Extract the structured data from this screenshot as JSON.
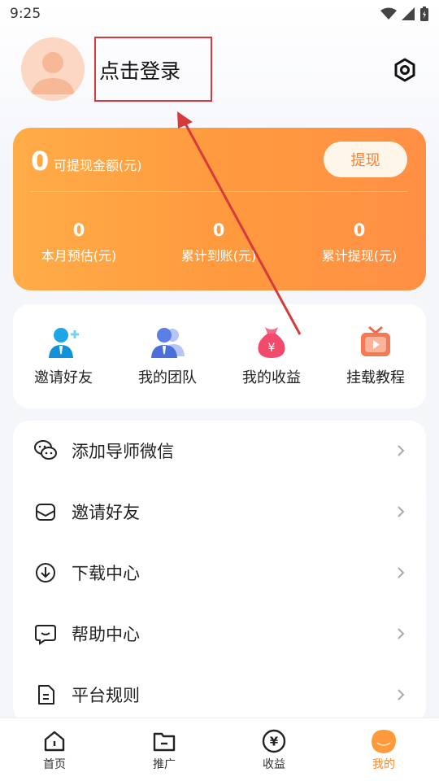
{
  "status_bar": {
    "time": "9:25"
  },
  "profile": {
    "login_text": "点击登录"
  },
  "earnings": {
    "withdrawable_amount": "0",
    "withdrawable_label": "可提现金额(元)",
    "withdraw_button": "提现",
    "stats": [
      {
        "value": "0",
        "label": "本月预估(元)"
      },
      {
        "value": "0",
        "label": "累计到账(元)"
      },
      {
        "value": "0",
        "label": "累计提现(元)"
      }
    ]
  },
  "quick_actions": [
    {
      "label": "邀请好友",
      "icon": "invite-friend-icon"
    },
    {
      "label": "我的团队",
      "icon": "team-icon"
    },
    {
      "label": "我的收益",
      "icon": "money-bag-icon"
    },
    {
      "label": "挂载教程",
      "icon": "tv-tutorial-icon"
    }
  ],
  "menu": [
    {
      "label": "添加导师微信",
      "icon": "wechat-icon"
    },
    {
      "label": "邀请好友",
      "icon": "envelope-icon"
    },
    {
      "label": "下载中心",
      "icon": "download-icon"
    },
    {
      "label": "帮助中心",
      "icon": "chat-help-icon"
    },
    {
      "label": "平台规则",
      "icon": "document-icon"
    }
  ],
  "tabbar": [
    {
      "label": "首页",
      "icon": "home-icon",
      "active": false
    },
    {
      "label": "推广",
      "icon": "folder-icon",
      "active": false
    },
    {
      "label": "收益",
      "icon": "yen-icon",
      "active": false
    },
    {
      "label": "我的",
      "icon": "profile-icon",
      "active": true
    }
  ],
  "colors": {
    "accent": "#ff8a2d",
    "card_gradient_start": "#ffac48",
    "card_gradient_end": "#ff8f45",
    "annotation_red": "#d73a3a"
  }
}
